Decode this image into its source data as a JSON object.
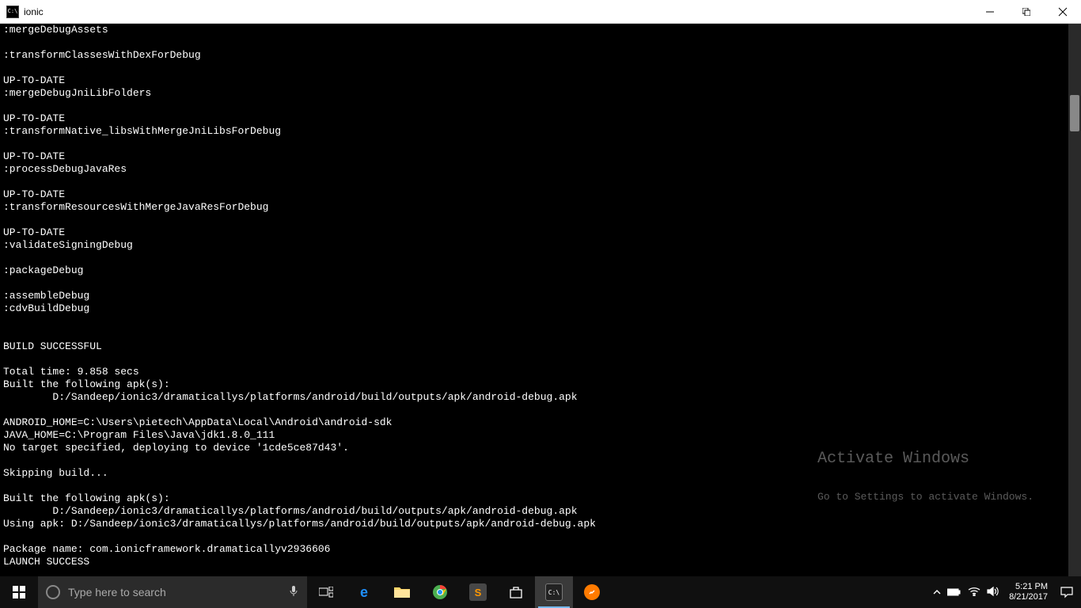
{
  "titlebar": {
    "title": "ionic"
  },
  "terminal": {
    "lines": [
      ":mergeDebugAssets",
      "",
      ":transformClassesWithDexForDebug",
      "",
      "UP-TO-DATE",
      ":mergeDebugJniLibFolders",
      "",
      "UP-TO-DATE",
      ":transformNative_libsWithMergeJniLibsForDebug",
      "",
      "UP-TO-DATE",
      ":processDebugJavaRes",
      "",
      "UP-TO-DATE",
      ":transformResourcesWithMergeJavaResForDebug",
      "",
      "UP-TO-DATE",
      ":validateSigningDebug",
      "",
      ":packageDebug",
      "",
      ":assembleDebug",
      ":cdvBuildDebug",
      "",
      "",
      "BUILD SUCCESSFUL",
      "",
      "Total time: 9.858 secs",
      "Built the following apk(s):",
      "        D:/Sandeep/ionic3/dramaticallys/platforms/android/build/outputs/apk/android-debug.apk",
      "",
      "ANDROID_HOME=C:\\Users\\pietech\\AppData\\Local\\Android\\android-sdk",
      "JAVA_HOME=C:\\Program Files\\Java\\jdk1.8.0_111",
      "No target specified, deploying to device '1cde5ce87d43'.",
      "",
      "Skipping build...",
      "",
      "Built the following apk(s):",
      "        D:/Sandeep/ionic3/dramaticallys/platforms/android/build/outputs/apk/android-debug.apk",
      "Using apk: D:/Sandeep/ionic3/dramaticallys/platforms/android/build/outputs/apk/android-debug.apk",
      "",
      "Package name: com.ionicframework.dramaticallyv2936606",
      "LAUNCH SUCCESS"
    ]
  },
  "watermark": {
    "heading": "Activate Windows",
    "sub": "Go to Settings to activate Windows."
  },
  "taskbar": {
    "search_placeholder": "Type here to search",
    "clock_time": "5:21 PM",
    "clock_date": "8/21/2017"
  }
}
